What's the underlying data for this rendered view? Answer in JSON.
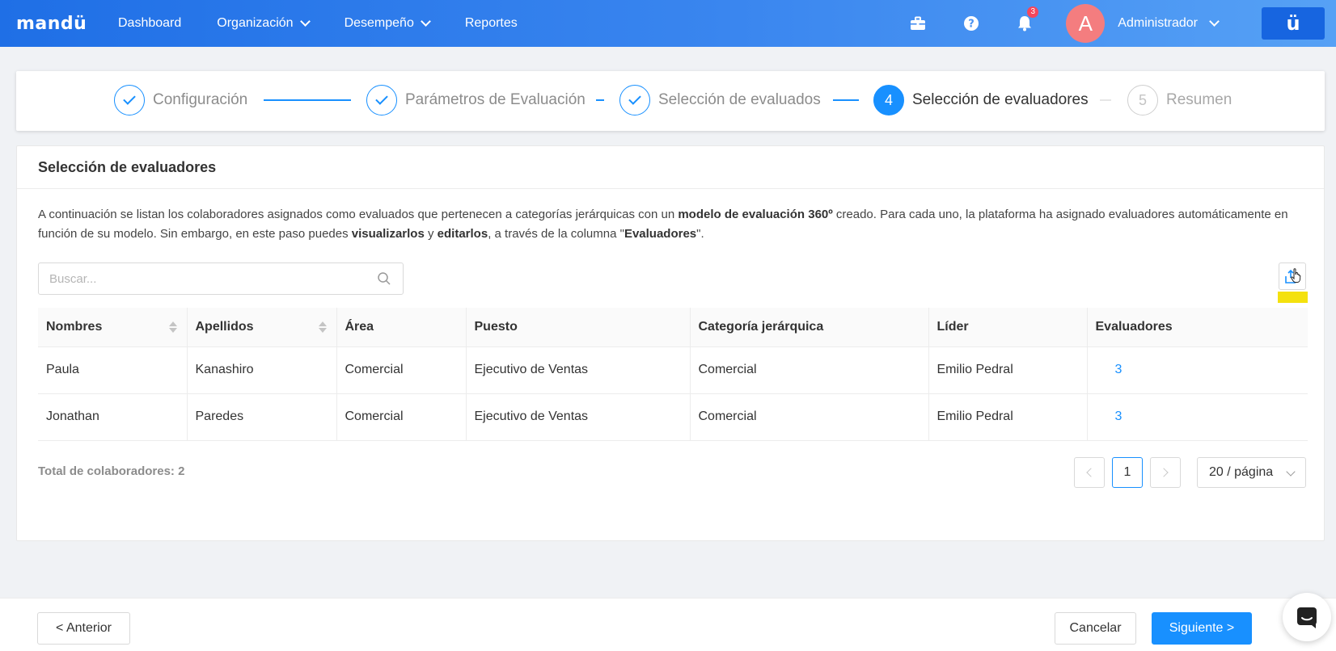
{
  "app": {
    "logo": "mandü",
    "brand_button": "ü"
  },
  "topbar": {
    "nav": [
      {
        "label": "Dashboard"
      },
      {
        "label": "Organización"
      },
      {
        "label": "Desempeño"
      },
      {
        "label": "Reportes"
      }
    ],
    "notifications_count": "3",
    "user": {
      "initial": "A",
      "name": "Administrador"
    }
  },
  "steps": [
    {
      "number": "1",
      "label": "Configuración",
      "status": "done"
    },
    {
      "number": "2",
      "label": "Parámetros de Evaluación",
      "status": "done"
    },
    {
      "number": "3",
      "label": "Selección de evaluados",
      "status": "done"
    },
    {
      "number": "4",
      "label": "Selección de evaluadores",
      "status": "active"
    },
    {
      "number": "5",
      "label": "Resumen",
      "status": "pending"
    }
  ],
  "card": {
    "title": "Selección de evaluadores",
    "desc": {
      "p1": "A continuación se listan los colaboradores asignados como evaluados que pertenecen a categorías jerárquicas con un ",
      "b1": "modelo de evaluación 360º",
      "p2": " creado. Para cada uno, la plataforma ha asignado evaluadores automáticamente en función de su modelo. Sin embargo, en este paso puedes ",
      "b2": "visualizarlos",
      "p3": " y ",
      "b3": "editarlos",
      "p4": ", a través de la columna \"",
      "b4": "Evaluadores",
      "p5": "\"."
    },
    "search_placeholder": "Buscar..."
  },
  "table": {
    "headers": [
      "Nombres",
      "Apellidos",
      "Área",
      "Puesto",
      "Categoría jerárquica",
      "Líder",
      "Evaluadores"
    ],
    "rows": [
      [
        "Paula",
        "Kanashiro",
        "Comercial",
        "Ejecutivo de Ventas",
        "Comercial",
        "Emilio Pedral",
        "3"
      ],
      [
        "Jonathan",
        "Paredes",
        "Comercial",
        "Ejecutivo de Ventas",
        "Comercial",
        "Emilio Pedral",
        "3"
      ]
    ]
  },
  "footer": {
    "total": "Total de colaboradores: 2",
    "current_page": "1",
    "page_size": "20 / página"
  },
  "actions": {
    "previous": "< Anterior",
    "cancel": "Cancelar",
    "next": "Siguiente >"
  },
  "colors": {
    "primary": "#1890ff",
    "topbar_start": "#1f6fe6",
    "topbar_end": "#56a1f5",
    "badge": "#f5475c",
    "avatar": "#f47d7f",
    "highlight": "#f4e10e"
  }
}
